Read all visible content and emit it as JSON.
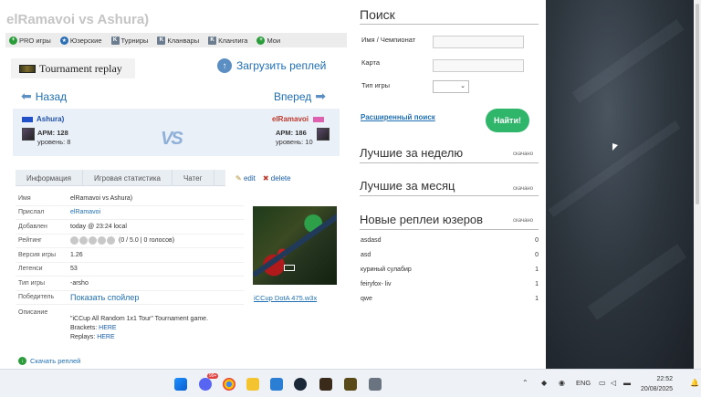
{
  "page_title": "elRamavoi vs Ashura)",
  "tabs": [
    {
      "label": "PRO игры",
      "icon": "plus-icon"
    },
    {
      "label": "Юзерские",
      "icon": "star-icon"
    },
    {
      "label": "Турниры",
      "icon": "k-icon"
    },
    {
      "label": "Кланвары",
      "icon": "k-icon"
    },
    {
      "label": "Кланлига",
      "icon": "k-icon"
    },
    {
      "label": "Мои",
      "icon": "plus-icon"
    }
  ],
  "tournament_replay": "Tournament replay",
  "upload_label": "Загрузить реплей",
  "nav": {
    "prev": "Назад",
    "next": "Вперед"
  },
  "player_left": {
    "name": "Ashura)",
    "apm": "APM: 128",
    "level": "уровень: 8",
    "color": "#2150c8"
  },
  "player_right": {
    "name": "elRamavoi",
    "apm": "APM: 186",
    "level": "уровень: 10",
    "color": "#e060b0"
  },
  "vs_text": "VS",
  "info_tabs": [
    "Информация",
    "Игровая статистика",
    "Чатег"
  ],
  "actions": {
    "edit": "edit",
    "delete": "delete"
  },
  "info": [
    {
      "key": "Имя",
      "value": "elRamavoi vs Ashura)"
    },
    {
      "key": "Прислал",
      "value": "elRamavoi"
    },
    {
      "key": "Добавлен",
      "value": "today @ 23:24 local"
    },
    {
      "key": "Рейтинг",
      "value": "(0 / 5.0 | 0 голосов)"
    },
    {
      "key": "Версия игры",
      "value": "1.26"
    },
    {
      "key": "Летенси",
      "value": "53"
    },
    {
      "key": "Тип игры",
      "value": "-arsho"
    },
    {
      "key": "Победитель",
      "value": "Показать спойлер"
    }
  ],
  "desc_label": "Описание",
  "description": {
    "line1": "\"iCCup All Random 1x1 Tour\" Tournament game.",
    "brackets_label": "Brackets:",
    "brackets_link": "HERE",
    "replays_label": "Replays:",
    "replays_link": "HERE"
  },
  "map_caption": "iCCup DotA 475.w3x",
  "download_label": "Скачать реплей",
  "search": {
    "title": "Поиск",
    "name_label": "Имя / Чемпионат",
    "map_label": "Карта",
    "type_label": "Тип игры",
    "advanced": "Расширенный поиск",
    "button": "Найти!"
  },
  "best_week": {
    "title": "Лучшие за неделю",
    "dl": "скачано"
  },
  "best_month": {
    "title": "Лучшие за месяц",
    "dl": "скачано"
  },
  "new_user": {
    "title": "Новые реплеи юзеров",
    "dl": "скачано",
    "rows": [
      {
        "name": "asdasd",
        "count": "0"
      },
      {
        "name": "asd",
        "count": "0"
      },
      {
        "name": "куриный сулабир",
        "count": "1"
      },
      {
        "name": "feiryfox- liv",
        "count": "1"
      },
      {
        "name": "qwe",
        "count": "1"
      }
    ]
  },
  "taskbar": {
    "lang": "ENG",
    "time": "22:52",
    "date": "20/08/2025",
    "badge": "99+"
  }
}
